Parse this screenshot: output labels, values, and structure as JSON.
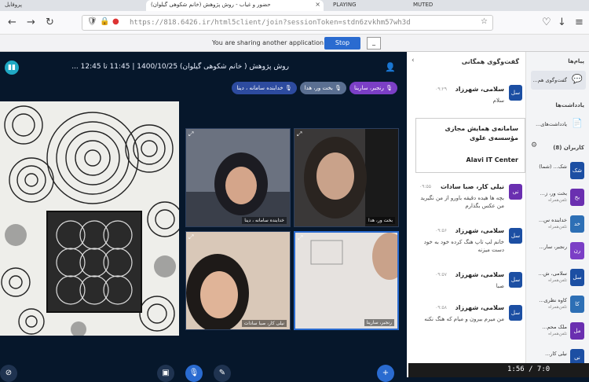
{
  "browser": {
    "tabs": [
      "حضور و غیاب - روش پژوهش (خانم شکوهی گیلوان)",
      "PLAYING",
      "MUTED",
      "پروفایل"
    ],
    "url": "https://818.6426.ir/html5client/join?sessionToken=stdn6zvkhm57wh3d"
  },
  "share_bar": {
    "message": "You are sharing another application window.",
    "stop_label": "Stop Sharing",
    "minimize_label": "_"
  },
  "meeting": {
    "title": "روش پژوهش ( خانم شکوهی گیلوان) 1400/10/25 | 11:45 تا 12:45 ...",
    "talking": [
      {
        "label": "رنجبر، سارینا",
        "color": "#7b3fc6"
      },
      {
        "label": "بخت ور، هدا",
        "color": "#5a6f91"
      },
      {
        "label": "خدابنده سامانه ، دینا",
        "color": "#2d4b9f"
      }
    ],
    "videos": [
      {
        "name": "خدابنده سامانه ، دینا"
      },
      {
        "name": "بخت ور، هدا"
      },
      {
        "name": "نیلی کار، صبا سادات"
      },
      {
        "name": "رنجبر، سارینا"
      }
    ]
  },
  "chat": {
    "title": "گفت‌وگوی همگانی",
    "welcome_title": "سامانه‌ی همایش مجازی مؤسسه‌ی علوی",
    "welcome_sub": "Alavi IT Center",
    "messages": [
      {
        "avatar": "سل",
        "name": "سلامی، شهرزاد",
        "time": "۰۹:۲۹",
        "text": "سلام",
        "color": "#1c4fa3"
      },
      {
        "avatar": "نی",
        "name": "نیلی کار، صبا سادات",
        "time": "۰۹:۵۵",
        "text": "بچه ها هیده دقیقه باورو از من نگیرید من عکس بگذارم",
        "color": "#6a2fb0"
      },
      {
        "avatar": "سل",
        "name": "سلامی، شهرزاد",
        "time": "۰۹:۵۶",
        "text": "خانم لپ تاپ هنگ کرده خود به خود دست میزنه",
        "color": "#1c4fa3"
      },
      {
        "avatar": "سل",
        "name": "سلامی، شهرزاد",
        "time": "۰۹:۵۷",
        "text": "صبا",
        "color": "#1c4fa3"
      },
      {
        "avatar": "سل",
        "name": "سلامی، شهرزاد",
        "time": "۰۹:۵۸",
        "text": "من میرم بیرون و میام که هنگ نکنه",
        "color": "#1c4fa3"
      }
    ]
  },
  "side": {
    "messages_head": "پیام‌ها",
    "chat_item": "گفت‌وگوی هم...",
    "notes_head": "یادداشت‌ها",
    "notes_item": "یادداشت‌های...",
    "users_head": "کاربران (8)",
    "users": [
      {
        "avatar": "شک",
        "name": "شک... (شما)",
        "role": "",
        "color": "#1c4fa3"
      },
      {
        "avatar": "بخ",
        "name": "بخت ور، ز...",
        "role": "تلفن‌همراه",
        "color": "#6a2fb0"
      },
      {
        "avatar": "خد",
        "name": "خدابنده س...",
        "role": "تلفن‌همراه",
        "color": "#2d6fb5"
      },
      {
        "avatar": "رن",
        "name": "رنجبر، سار...",
        "role": "",
        "color": "#7b3fc6"
      },
      {
        "avatar": "سل",
        "name": "سلامی، ش...",
        "role": "تلفن‌همراه",
        "color": "#1c4fa3"
      },
      {
        "avatar": "کا",
        "name": "کاوه نظری...",
        "role": "تلفن‌همراه",
        "color": "#2d6fb5"
      },
      {
        "avatar": "مل",
        "name": "ملک محم...",
        "role": "تلفن‌همراه",
        "color": "#6a2fb0"
      },
      {
        "avatar": "نی",
        "name": "نیلی کار...",
        "role": "",
        "color": "#1c4fa3"
      }
    ]
  },
  "taskbar": {
    "time": "1:56 / 7:0"
  }
}
